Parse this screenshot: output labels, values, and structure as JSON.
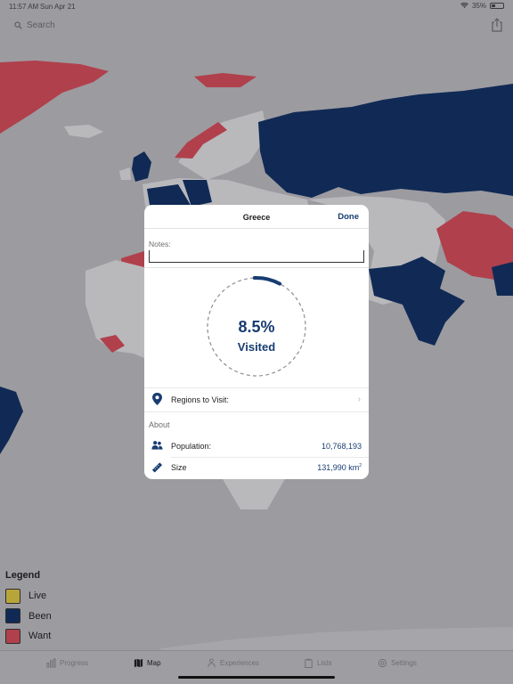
{
  "status_bar": {
    "time": "11:57 AM",
    "date": "Sun Apr 21",
    "battery": "35%"
  },
  "search": {
    "placeholder": "Search"
  },
  "colors": {
    "live": "#b7a53a",
    "been": "#102a55",
    "want": "#b0404c",
    "accent": "#183c72",
    "land": "#b9b9bc",
    "ocean": "#9c9ba0"
  },
  "legend": {
    "title": "Legend",
    "items": [
      {
        "label": "Live",
        "color": "#b7a53a"
      },
      {
        "label": "Been",
        "color": "#102a55"
      },
      {
        "label": "Want",
        "color": "#b0404c"
      }
    ]
  },
  "card": {
    "title": "Greece",
    "done_label": "Done",
    "notes_label": "Notes:",
    "notes_value": "",
    "progress_value": "8.5%",
    "progress_label": "Visited",
    "progress_fraction": 0.085,
    "regions_label": "Regions to Visit:",
    "about_label": "About",
    "population_label": "Population:",
    "population_value": "10,768,193",
    "size_label": "Size",
    "size_value": "131,990 km",
    "size_unit_sup": "2"
  },
  "tabs": [
    {
      "label": "Progress",
      "icon": "chart-icon",
      "active": false
    },
    {
      "label": "Map",
      "icon": "map-icon",
      "active": true
    },
    {
      "label": "Experiences",
      "icon": "person-icon",
      "active": false
    },
    {
      "label": "Lists",
      "icon": "clipboard-icon",
      "active": false
    },
    {
      "label": "Settings",
      "icon": "gear-icon",
      "active": false
    }
  ]
}
